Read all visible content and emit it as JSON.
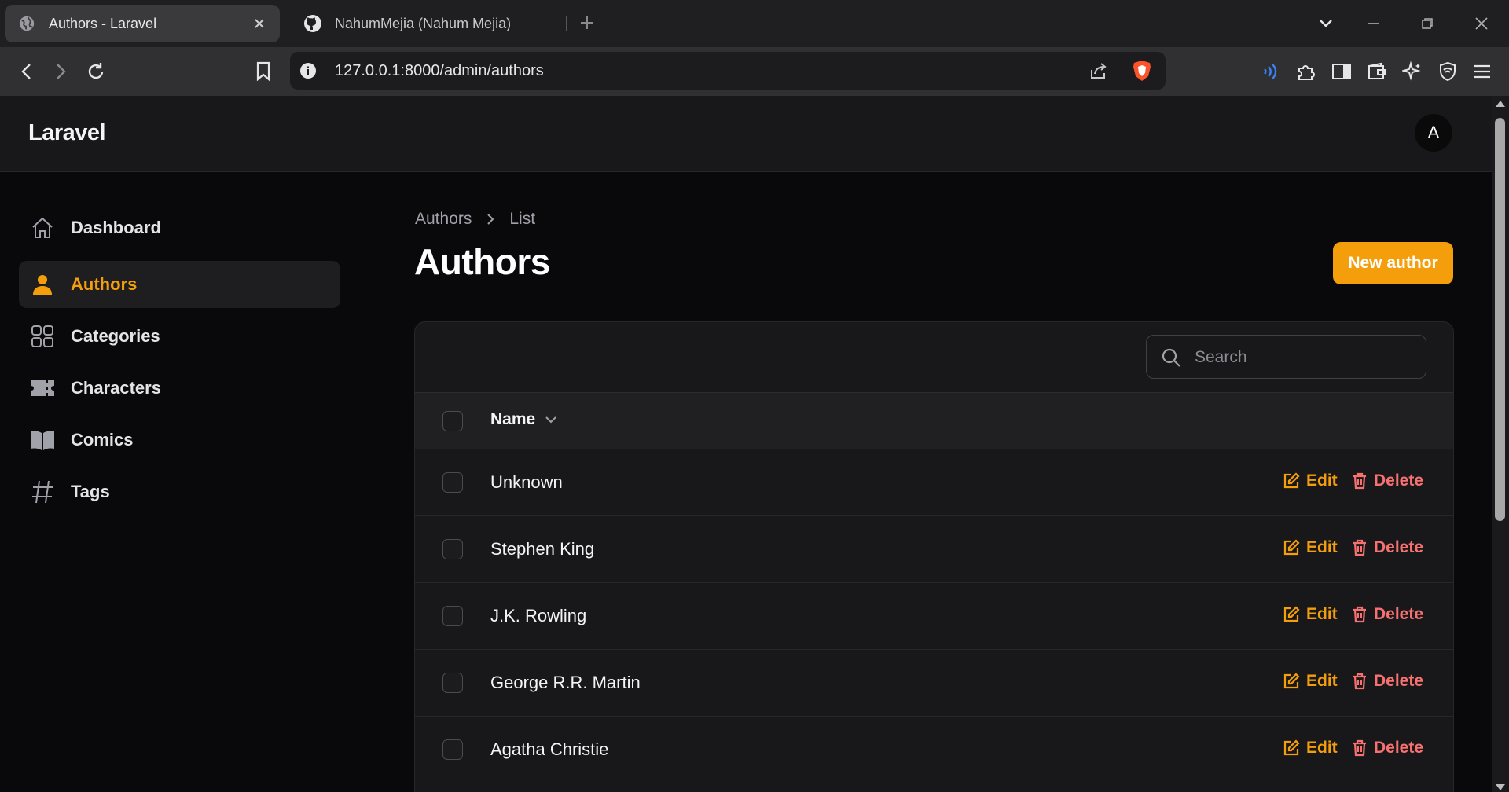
{
  "browser": {
    "tabs": [
      {
        "title": "Authors - Laravel",
        "favicon": "globe-icon",
        "active": true
      },
      {
        "title": "NahumMejia (Nahum Mejia)",
        "favicon": "github-icon",
        "active": false
      }
    ],
    "url": "127.0.0.1:8000/admin/authors"
  },
  "app": {
    "brand": "Laravel",
    "avatar_initial": "A",
    "accent": "#f59e0b",
    "danger": "#f87171"
  },
  "sidebar": {
    "items": [
      {
        "label": "Dashboard",
        "icon": "home-icon",
        "active": false
      },
      {
        "label": "Authors",
        "icon": "user-icon",
        "active": true
      },
      {
        "label": "Categories",
        "icon": "grid-icon",
        "active": false
      },
      {
        "label": "Characters",
        "icon": "ticket-icon",
        "active": false
      },
      {
        "label": "Comics",
        "icon": "book-icon",
        "active": false
      },
      {
        "label": "Tags",
        "icon": "hashtag-icon",
        "active": false
      }
    ]
  },
  "main": {
    "breadcrumb": [
      "Authors",
      "List"
    ],
    "title": "Authors",
    "new_button": "New author",
    "search_placeholder": "Search",
    "column_name": "Name",
    "edit_label": "Edit",
    "delete_label": "Delete",
    "rows": [
      "Unknown",
      "Stephen King",
      "J.K. Rowling",
      "George R.R. Martin",
      "Agatha Christie"
    ]
  }
}
